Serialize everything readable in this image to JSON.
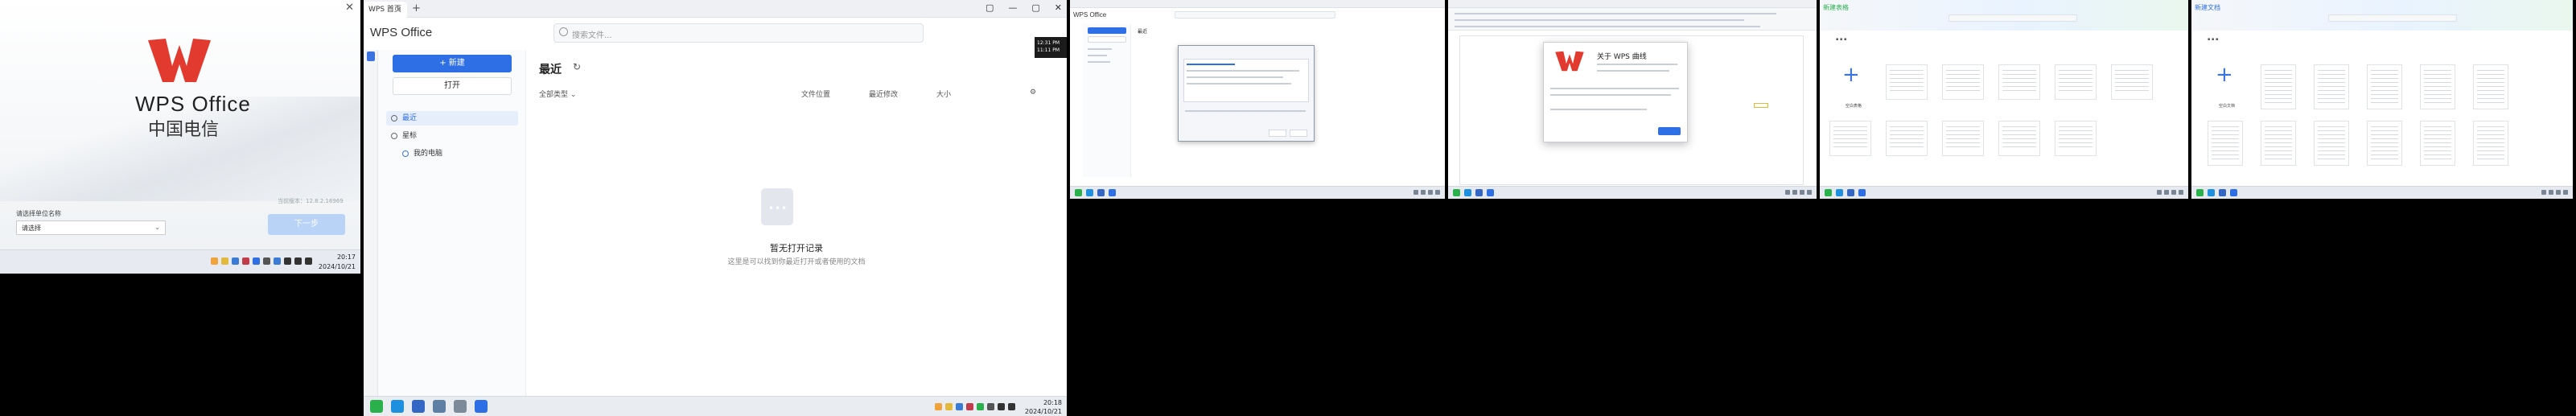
{
  "setup": {
    "close": "✕",
    "brand": "WPS Office",
    "operator": "中国电信",
    "version": "当前版本：12.8.2.16969",
    "select_label": "请选择单位名称",
    "select_value": "请选择",
    "next": "下一步",
    "taskbar_time": "20:17",
    "taskbar_date": "2024/10/21"
  },
  "home": {
    "tab_label": "WPS 首页",
    "tab_close": "×",
    "new_tab": "+",
    "win_buttons": [
      "▢",
      "—",
      "▢",
      "✕"
    ],
    "app_title": "WPS Office",
    "search_placeholder": "搜索文件...",
    "new_button": "+ 新建",
    "open_button": "打开",
    "nav": [
      {
        "label": "最近"
      },
      {
        "label": "星标"
      },
      {
        "label": "我的电脑"
      }
    ],
    "recent_title": "最近",
    "columns": {
      "type": "全部类型 ⌄",
      "location": "文件位置",
      "modified": "最近修改",
      "size": "大小"
    },
    "empty_title": "暂无打开记录",
    "empty_sub": "这里是可以找到你最近打开或者使用的文档",
    "tip": "12:31 PM\n11:11 PM",
    "taskbar_time": "20:18",
    "taskbar_date": "2024/10/21"
  },
  "panel3": {
    "title": "WPS Office",
    "recent": "最近"
  },
  "panel4": {
    "about_title": "关于 WPS 曲线"
  },
  "panel5": {
    "title": "新建表格",
    "caption": "空白表格"
  },
  "panel6": {
    "title": "新建文档",
    "caption": "空白文档"
  },
  "colors": {
    "accent": "#2f6fe6",
    "wps_red": "#e33a2f"
  }
}
